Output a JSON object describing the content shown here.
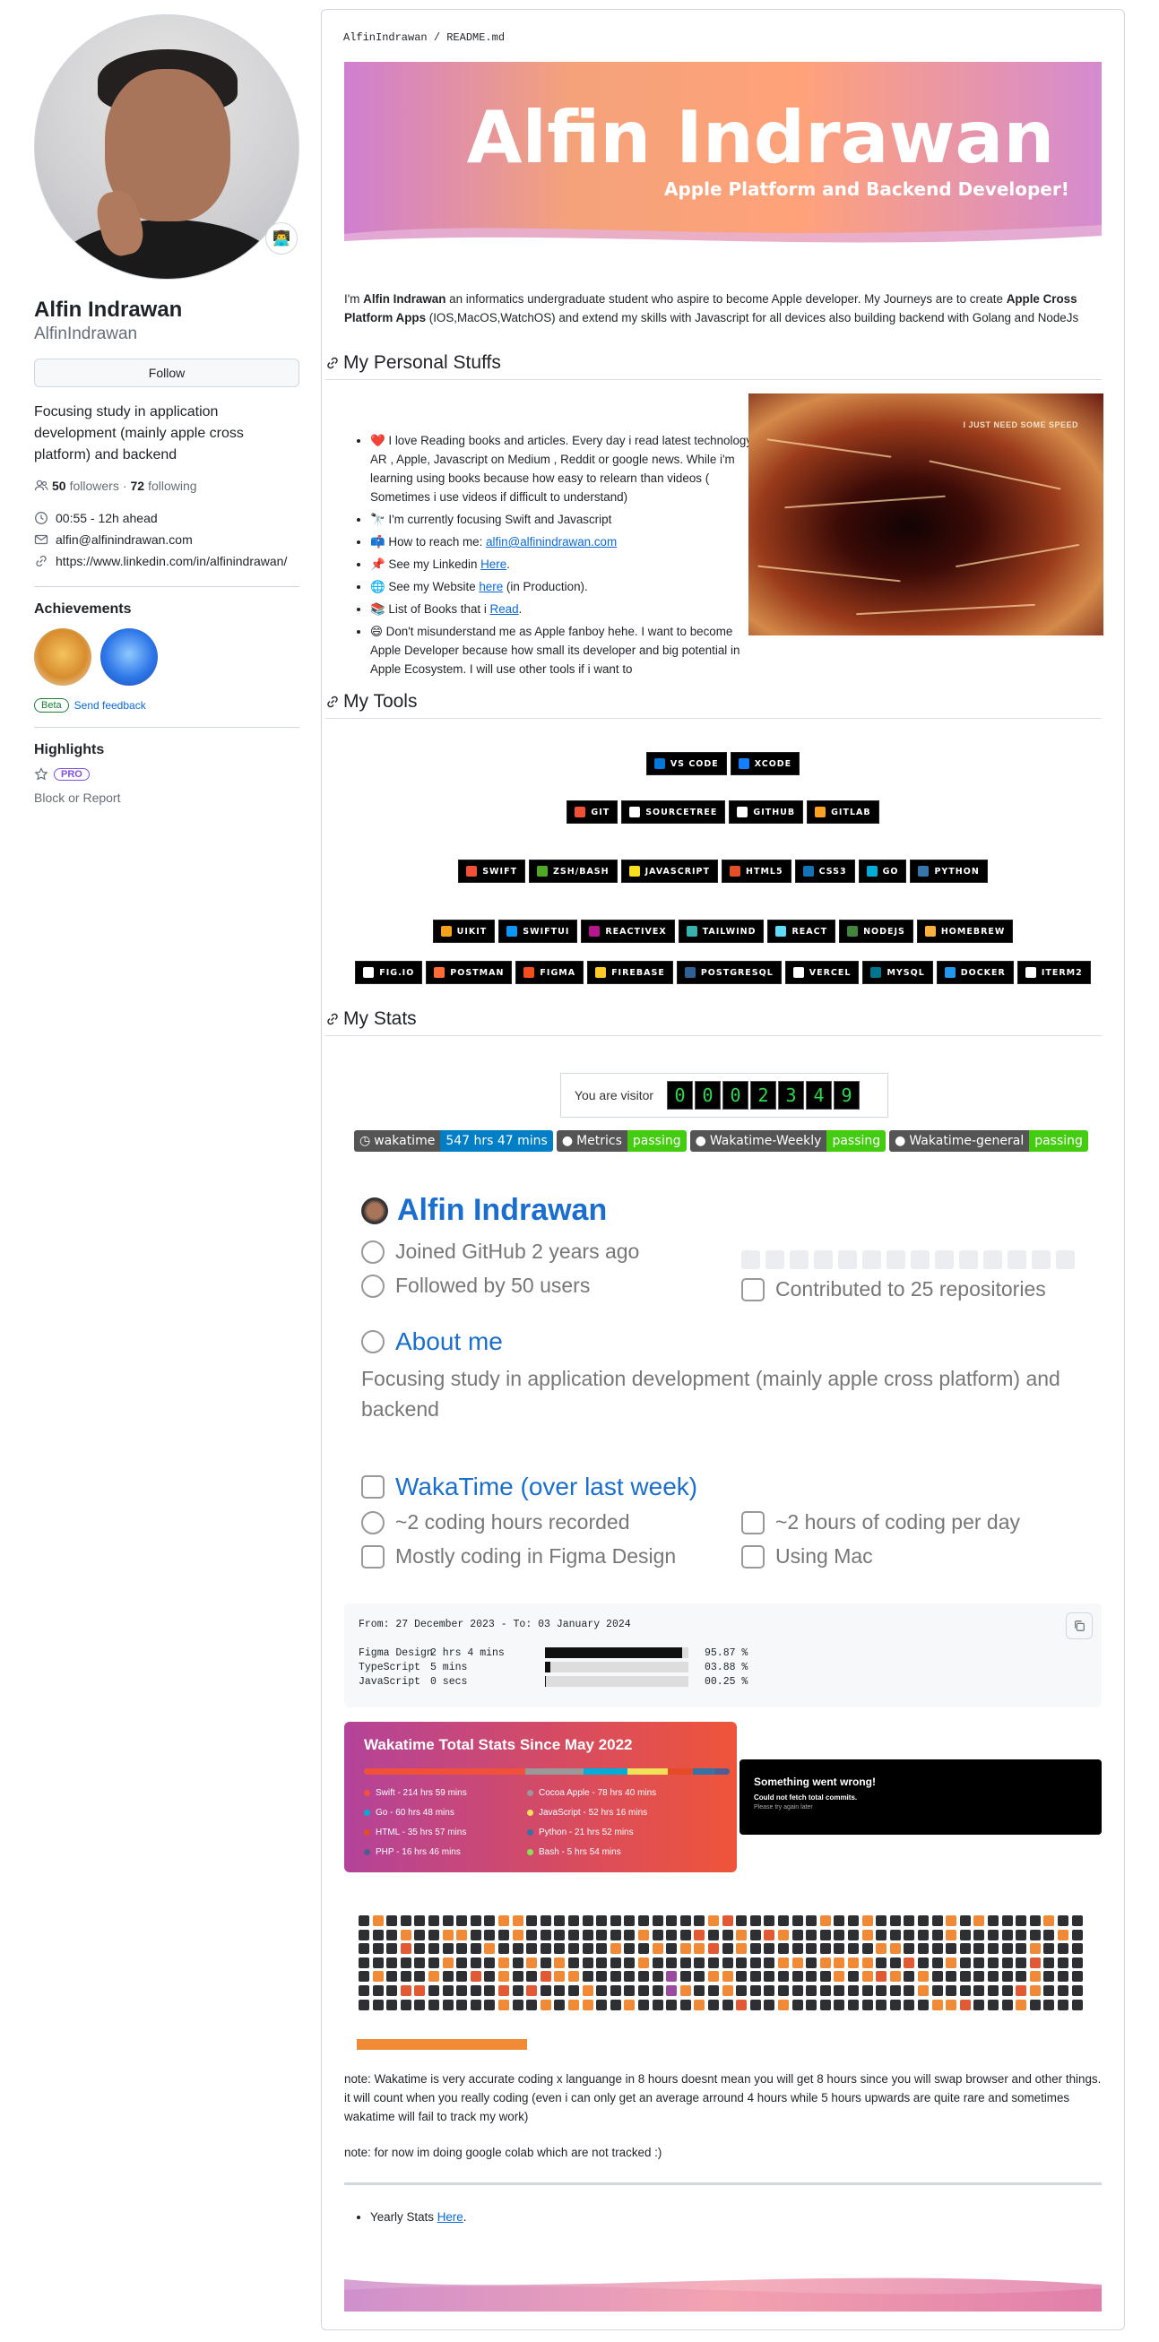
{
  "sidebar": {
    "fullname": "Alfin Indrawan",
    "username": "AlfinIndrawan",
    "follow_label": "Follow",
    "bio": "Focusing study in application development (mainly apple cross platform) and backend",
    "followers_count": "50",
    "followers_label": "followers",
    "separator": "·",
    "following_count": "72",
    "following_label": "following",
    "time": "00:55 - 12h ahead",
    "email": "alfin@alfinindrawan.com",
    "link": "https://www.linkedin.com/in/alfinindrawan/",
    "achievements_title": "Achievements",
    "beta_label": "Beta",
    "feedback_label": "Send feedback",
    "highlights_title": "Highlights",
    "pro_label": "PRO",
    "block_label": "Block or Report"
  },
  "readme": {
    "breadcrumb": "AlfinIndrawan / README.md",
    "banner_title": "Alfin Indrawan",
    "banner_subtitle": "Apple Platform and Backend Developer!",
    "intro_pre": "I'm ",
    "intro_name": "Alfin Indrawan",
    "intro_mid": " an informatics undergraduate student who aspire to become Apple developer. My Journeys are to create ",
    "intro_bold": "Apple Cross Platform Apps",
    "intro_post": " (IOS,MacOS,WatchOS) and extend my skills with Javascript for all devices also building backend with Golang and NodeJs",
    "h_personal": "My Personal Stuffs",
    "h_tools": "My Tools",
    "h_stats": "My Stats",
    "gif_caption": "I JUST NEED SOME SPEED",
    "personal": {
      "item1": "❤️ I love Reading books and articles. Every day i read latest technology AR , Apple, Javascript on Medium , Reddit or google news. While i'm learning using books because how easy to relearn than videos ( Sometimes i use videos if difficult to understand)",
      "item2": "🔭 I'm currently focusing Swift and Javascript",
      "item3_pre": "📫 How to reach me: ",
      "item3_link": "alfin@alfinindrawan.com",
      "item4_pre": "📌 See my Linkedin ",
      "item4_link": "Here",
      "item4_post": ".",
      "item5_pre": "🌐 See my Website ",
      "item5_link": "here",
      "item5_post": " (in Production).",
      "item6_pre": "📚 List of Books that i ",
      "item6_link": "Read",
      "item6_post": ".",
      "item7": "😄 Don't misunderstand me as Apple fanboy hehe. I want to become Apple Developer because how small its developer and big potential in Apple Ecosystem. I will use other tools if i want to"
    },
    "tools": {
      "row1": [
        {
          "label": "VS CODE",
          "color": "#0078d7"
        },
        {
          "label": "XCODE",
          "color": "#147efb"
        }
      ],
      "row2": [
        {
          "label": "GIT",
          "color": "#f05033"
        },
        {
          "label": "SOURCETREE",
          "color": "#ffffff"
        },
        {
          "label": "GITHUB",
          "color": "#ffffff"
        },
        {
          "label": "GITLAB",
          "color": "#fca121"
        }
      ],
      "row3": [
        {
          "label": "SWIFT",
          "color": "#f05138"
        },
        {
          "label": "ZSH/BASH",
          "color": "#4eaa25"
        },
        {
          "label": "JAVASCRIPT",
          "color": "#f7df1e"
        },
        {
          "label": "HTML5",
          "color": "#e34f26"
        },
        {
          "label": "CSS3",
          "color": "#1572b6"
        },
        {
          "label": "GO",
          "color": "#00add8"
        },
        {
          "label": "PYTHON",
          "color": "#3776ab"
        }
      ],
      "row4": [
        {
          "label": "UIKIT",
          "color": "#f7a21b"
        },
        {
          "label": "SWIFTUI",
          "color": "#0d96f6"
        },
        {
          "label": "REACTIVEX",
          "color": "#b7178c"
        },
        {
          "label": "TAILWIND",
          "color": "#38b2ac"
        },
        {
          "label": "REACT",
          "color": "#61dafb"
        },
        {
          "label": "NODEJS",
          "color": "#43853d"
        },
        {
          "label": "HOMEBREW",
          "color": "#fbb040"
        }
      ],
      "row5": [
        {
          "label": "FIG.IO",
          "color": "#ffffff"
        },
        {
          "label": "POSTMAN",
          "color": "#ff6c37"
        },
        {
          "label": "FIGMA",
          "color": "#f24e1e"
        },
        {
          "label": "FIREBASE",
          "color": "#ffca28"
        },
        {
          "label": "POSTGRESQL",
          "color": "#316192"
        },
        {
          "label": "VERCEL",
          "color": "#ffffff"
        },
        {
          "label": "MYSQL",
          "color": "#00758f"
        },
        {
          "label": "DOCKER",
          "color": "#2496ed"
        },
        {
          "label": "ITERM2",
          "color": "#ffffff"
        }
      ]
    },
    "visitor_label": "You are visitor",
    "visitor_digits": [
      "0",
      "0",
      "0",
      "2",
      "3",
      "4",
      "9"
    ],
    "shields": [
      {
        "left": "wakatime",
        "right": "547 hrs 47 mins",
        "color": "#007ec6"
      },
      {
        "left": "Metrics",
        "right": "passing",
        "color": "#4c1"
      },
      {
        "left": "Wakatime-Weekly",
        "right": "passing",
        "color": "#4c1"
      },
      {
        "left": "Wakatime-general",
        "right": "passing",
        "color": "#4c1"
      }
    ],
    "metrics": {
      "name": "Alfin Indrawan",
      "joined": "Joined GitHub 2 years ago",
      "followed": "Followed by 50 users",
      "contributed": "Contributed to 25 repositories",
      "about_title": "About me",
      "about_text": "Focusing study in application development (mainly apple cross platform) and backend",
      "waka_title": "WakaTime (over last week)",
      "coding_recorded": "~2 coding hours recorded",
      "coding_per_day": "~2 hours of coding per day",
      "mostly": "Mostly coding in Figma Design",
      "using": "Using Mac"
    },
    "code": {
      "line1": "From: 27 December 2023 - To: 03 January 2024",
      "rows": [
        {
          "name": "Figma Design",
          "time": "2 hrs 4 mins",
          "percent_label": "95.87 %",
          "percent": 95.87
        },
        {
          "name": "TypeScript",
          "time": "5 mins",
          "percent_label": "03.88 %",
          "percent": 3.88
        },
        {
          "name": "JavaScript",
          "time": "0 secs",
          "percent_label": "00.25 %",
          "percent": 0.25
        }
      ]
    },
    "waka_card": {
      "title": "Wakatime Total Stats Since May 2022",
      "langs": [
        {
          "label": "Swift - 214 hrs 59 mins",
          "color": "#f05138"
        },
        {
          "label": "Cocoa Apple - 78 hrs 40 mins",
          "color": "#999999"
        },
        {
          "label": "Go - 60 hrs 48 mins",
          "color": "#00add8"
        },
        {
          "label": "JavaScript - 52 hrs 16 mins",
          "color": "#f1e05a"
        },
        {
          "label": "HTML - 35 hrs 57 mins",
          "color": "#e34c26"
        },
        {
          "label": "Python - 21 hrs 52 mins",
          "color": "#3572a5"
        },
        {
          "label": "PHP - 16 hrs 46 mins",
          "color": "#4f5d95"
        },
        {
          "label": "Bash - 5 hrs 54 mins",
          "color": "#89e051"
        }
      ]
    },
    "error_card": {
      "title": "Something went wrong!",
      "sub": "Could not fetch total commits.",
      "retry": "Please try again later"
    },
    "note1": "note: Wakatime is very accurate coding x languange in 8 hours doesnt mean you will get 8 hours since you will swap browser and other things. it will count when you really coding (even i can only get an average arround 4 hours while 5 hours upwards are quite rare and sometimes wakatime will fail to track my work)",
    "note2": "note: for now im doing google colab which are not tracked :)",
    "yearly_pre": "Yearly Stats ",
    "yearly_link": "Here",
    "yearly_post": "."
  }
}
